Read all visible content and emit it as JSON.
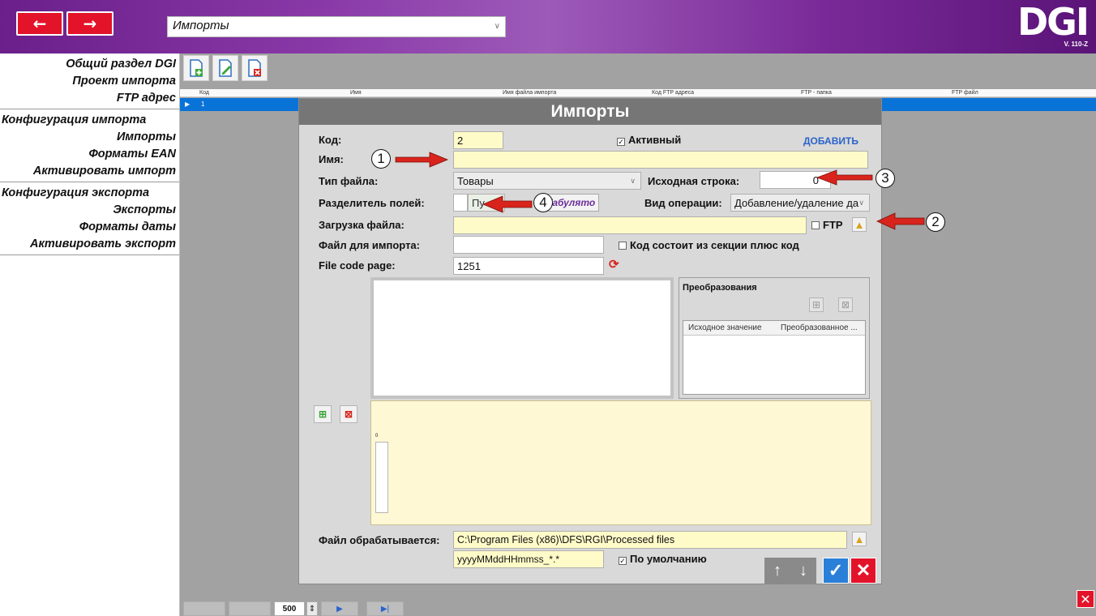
{
  "header": {
    "back_glyph": "←",
    "forward_glyph": "→",
    "section_value": "Импорты",
    "logo": "DGI",
    "version": "V. 110-Z"
  },
  "sidebar": {
    "group1": [
      "Общий раздел DGI",
      "Проект импорта",
      "FTP адрес"
    ],
    "group2_head": "Конфигурация импорта",
    "group2": [
      "Импорты",
      "Форматы EAN",
      "Активировать импорт"
    ],
    "group3_head": "Конфигурация экспорта",
    "group3": [
      "Экспорты",
      "Форматы даты",
      "Активировать экспорт"
    ]
  },
  "grid": {
    "columns": [
      "Код",
      "Имя",
      "Имя файла импорта",
      "Код FTP адреса",
      "FTP - папка",
      "FTP файл"
    ],
    "row": {
      "code": "1"
    }
  },
  "dialog": {
    "title": "Импорты",
    "code_label": "Код:",
    "code_value": "2",
    "active_label": "Активный",
    "add_label": "ДОБАВИТЬ",
    "name_label": "Имя:",
    "name_value": "",
    "filetype_label": "Тип файла:",
    "filetype_value": "Товары",
    "start_row_label": "Исходная строка:",
    "start_row_value": "0",
    "separator_label": "Разделитель полей:",
    "separator_value": "",
    "separator_hint": "Пу",
    "tab_button": "Табулято",
    "operation_label": "Вид операции:",
    "operation_value": "Добавление/удаление да",
    "upload_label": "Загрузка файла:",
    "upload_value": "",
    "ftp_label": "FTP",
    "import_file_label": "Файл для импорта:",
    "import_file_value": "",
    "section_code_label": "Код состоит из секции плюс код",
    "codepage_label": "File code page:",
    "codepage_value": "1251",
    "conversions_title": "Преобразования",
    "conv_col1": "Исходное значение",
    "conv_col2": "Преобразованное ...",
    "processed_label": "Файл обрабатывается:",
    "processed_value": "C:\\Program Files (x86)\\DFS\\RGI\\Processed files",
    "pattern_value": "yyyyMMddHHmmss_*.*",
    "default_label": "По умолчанию",
    "mini_value": "0"
  },
  "footer": {
    "page_size": "500"
  },
  "annotations": [
    "1",
    "2",
    "3",
    "4"
  ],
  "colors": {
    "header_purple": "#7a2a98",
    "red_button": "#e3132a",
    "selected_row": "#0a73d8",
    "field_yellow": "#fffbc8",
    "dialog_gray": "#d9d9d9",
    "title_gray": "#767676"
  }
}
